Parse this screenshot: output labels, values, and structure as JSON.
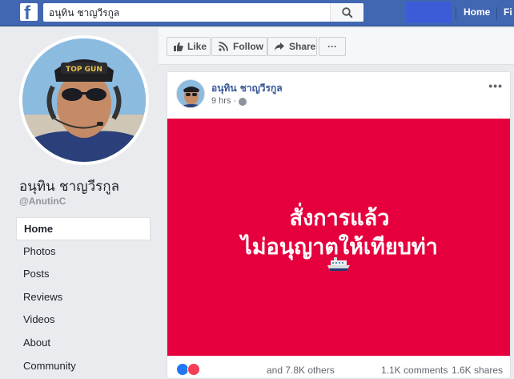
{
  "topbar": {
    "search_value": "อนุทิน ชาญวีรกูล",
    "home_label": "Home",
    "next_label": "Fi",
    "brand_color": "#4267b2"
  },
  "profile": {
    "name": "อนุทิน ชาญวีรกูล",
    "handle": "@AnutinC"
  },
  "leftnav": {
    "items": [
      {
        "label": "Home",
        "active": true
      },
      {
        "label": "Photos"
      },
      {
        "label": "Posts"
      },
      {
        "label": "Reviews"
      },
      {
        "label": "Videos"
      },
      {
        "label": "About"
      },
      {
        "label": "Community"
      }
    ]
  },
  "actions": {
    "like_label": "Like",
    "follow_label": "Follow",
    "share_label": "Share",
    "more_label": "···"
  },
  "post": {
    "author": "อนุทิน ชาญวีรกูล",
    "time": "9 hrs ·",
    "more_label": "•••",
    "banner_line1": "สั่งการแล้ว",
    "banner_line2": "ไม่อนุญาตให้เทียบท่า",
    "banner_color": "#e5003d",
    "reactions_text": "and 7.8K others",
    "comments_text": "1.1K comments",
    "shares_text": "1.6K shares"
  }
}
